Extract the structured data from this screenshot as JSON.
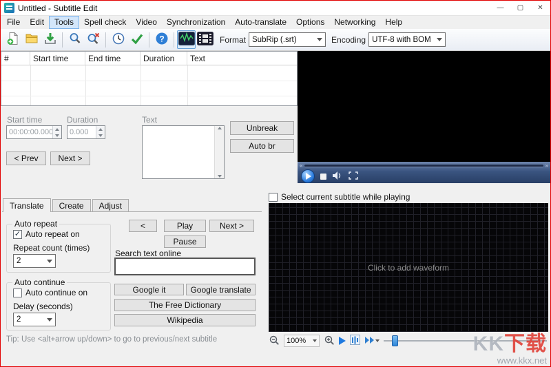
{
  "window": {
    "title": "Untitled - Subtitle Edit",
    "minimize": "—",
    "maximize": "▢",
    "close": "✕"
  },
  "menu": {
    "items": [
      "File",
      "Edit",
      "Tools",
      "Spell check",
      "Video",
      "Synchronization",
      "Auto-translate",
      "Options",
      "Networking",
      "Help"
    ]
  },
  "toolbar": {
    "format_label": "Format",
    "format_value": "SubRip (.srt)",
    "encoding_label": "Encoding",
    "encoding_value": "UTF-8 with BOM"
  },
  "subtitle_list": {
    "columns": [
      "#",
      "Start time",
      "End time",
      "Duration",
      "Text"
    ]
  },
  "edit_panel": {
    "start_time_label": "Start time",
    "start_time_value": "00:00:00.000",
    "duration_label": "Duration",
    "duration_value": "0.000",
    "text_label": "Text",
    "unbreak_button": "Unbreak",
    "auto_br_button": "Auto br",
    "prev_button": "< Prev",
    "next_button": "Next >"
  },
  "tabs": {
    "items": [
      "Translate",
      "Create",
      "Adjust"
    ]
  },
  "translate_tab": {
    "auto_repeat_group": "Auto repeat",
    "auto_repeat_checkbox": "Auto repeat on",
    "repeat_count_label": "Repeat count (times)",
    "repeat_count_value": "2",
    "auto_continue_group": "Auto continue",
    "auto_continue_checkbox": "Auto continue on",
    "delay_label": "Delay (seconds)",
    "delay_value": "2",
    "prev_button": "<",
    "play_button": "Play",
    "next_button": "Next >",
    "pause_button": "Pause",
    "search_label": "Search text online",
    "search_value": "",
    "search_buttons": [
      "Google it",
      "Google translate",
      "The Free Dictionary",
      "Wikipedia"
    ],
    "tip": "Tip: Use <alt+arrow up/down> to go to previous/next subtitle"
  },
  "waveform_panel": {
    "select_checkbox": "Select current subtitle while playing",
    "placeholder": "Click to add waveform",
    "zoom_value": "100%"
  },
  "watermark": {
    "kk": "KK",
    "xiazai": "下载",
    "url": "www.kkx.net"
  }
}
